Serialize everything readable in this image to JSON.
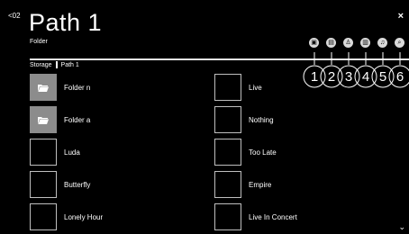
{
  "header": {
    "back_label": "<02",
    "title": "Path 1",
    "subtitle": "Folder",
    "close_glyph": "×"
  },
  "toolbar": {
    "icons": [
      {
        "name": "bus-icon",
        "glyph": "▣"
      },
      {
        "name": "list-icon",
        "glyph": "▤"
      },
      {
        "name": "person-icon",
        "glyph": "♙"
      },
      {
        "name": "document-icon",
        "glyph": "▥"
      },
      {
        "name": "music-icon",
        "glyph": "♫"
      },
      {
        "name": "search-icon",
        "glyph": "⌕"
      }
    ],
    "callouts": [
      "1",
      "2",
      "3",
      "4",
      "5",
      "6"
    ]
  },
  "breadcrumb": {
    "root": "Storage",
    "current": "Path 1"
  },
  "items": {
    "left": [
      {
        "label": "Folder n",
        "type": "folder"
      },
      {
        "label": "Folder a",
        "type": "folder"
      },
      {
        "label": "Luda",
        "type": "file"
      },
      {
        "label": "Butterfly",
        "type": "file"
      },
      {
        "label": "Lonely Hour",
        "type": "file"
      }
    ],
    "right": [
      {
        "label": "Live",
        "type": "file"
      },
      {
        "label": "Nothing",
        "type": "file"
      },
      {
        "label": "Too Late",
        "type": "file"
      },
      {
        "label": "Empire",
        "type": "file"
      },
      {
        "label": "Live In Concert",
        "type": "file"
      }
    ]
  },
  "footer": {
    "scroll_glyph": "⌄"
  },
  "colors": {
    "background": "#000000",
    "folder_thumb": "#8c8c8c",
    "thumb_border": "#bfbfbf",
    "icon_fill": "#d9d9d9"
  }
}
